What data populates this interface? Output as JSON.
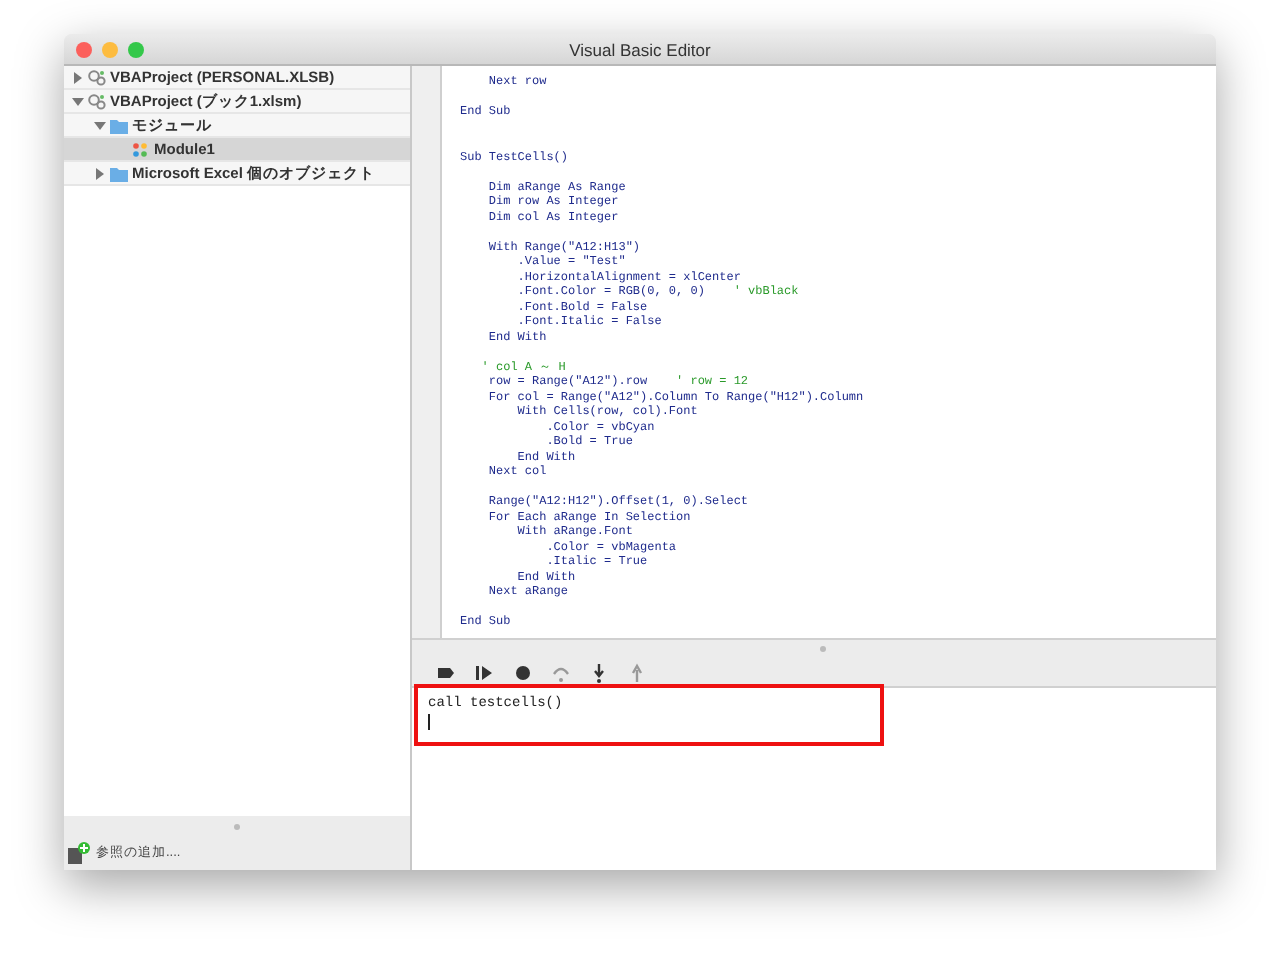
{
  "window": {
    "title": "Visual Basic Editor"
  },
  "project_tree": [
    {
      "label": "VBAProject (PERSONAL.XLSB)",
      "kind": "project",
      "expanded": false,
      "selected": false
    },
    {
      "label": "VBAProject (ブック1.xlsm)",
      "kind": "project",
      "expanded": true,
      "selected": false,
      "children": [
        {
          "label": "モジュール",
          "kind": "folder",
          "expanded": true,
          "selected": false,
          "children": [
            {
              "label": "Module1",
              "kind": "module",
              "selected": true
            }
          ]
        },
        {
          "label": "Microsoft Excel 個のオブジェクト",
          "kind": "folder",
          "expanded": false,
          "selected": false
        }
      ]
    }
  ],
  "footer": {
    "label": "参照の追加...."
  },
  "code_lines": [
    {
      "kind": "code",
      "code": "    Next row"
    },
    {
      "kind": "blank"
    },
    {
      "kind": "code",
      "code": "End Sub"
    },
    {
      "kind": "blank"
    },
    {
      "kind": "blank"
    },
    {
      "kind": "code",
      "code": "Sub TestCells()"
    },
    {
      "kind": "blank"
    },
    {
      "kind": "code",
      "code": "    Dim aRange As Range"
    },
    {
      "kind": "code",
      "code": "    Dim row As Integer"
    },
    {
      "kind": "code",
      "code": "    Dim col As Integer"
    },
    {
      "kind": "blank"
    },
    {
      "kind": "code",
      "code": "    With Range(\"A12:H13\")"
    },
    {
      "kind": "code",
      "code": "        .Value = \"Test\""
    },
    {
      "kind": "code",
      "code": "        .HorizontalAlignment = xlCenter"
    },
    {
      "kind": "code",
      "code": "        .Font.Color = RGB(0, 0, 0)    ",
      "comment": "' vbBlack"
    },
    {
      "kind": "code",
      "code": "        .Font.Bold = False"
    },
    {
      "kind": "code",
      "code": "        .Font.Italic = False"
    },
    {
      "kind": "code",
      "code": "    End With"
    },
    {
      "kind": "blank"
    },
    {
      "kind": "comment",
      "comment": "' col A ～ H"
    },
    {
      "kind": "code",
      "code": "    row = Range(\"A12\").row    ",
      "comment": "' row = 12"
    },
    {
      "kind": "code",
      "code": "    For col = Range(\"A12\").Column To Range(\"H12\").Column"
    },
    {
      "kind": "code",
      "code": "        With Cells(row, col).Font"
    },
    {
      "kind": "code",
      "code": "            .Color = vbCyan"
    },
    {
      "kind": "code",
      "code": "            .Bold = True"
    },
    {
      "kind": "code",
      "code": "        End With"
    },
    {
      "kind": "code",
      "code": "    Next col"
    },
    {
      "kind": "blank"
    },
    {
      "kind": "code",
      "code": "    Range(\"A12:H12\").Offset(1, 0).Select"
    },
    {
      "kind": "code",
      "code": "    For Each aRange In Selection"
    },
    {
      "kind": "code",
      "code": "        With aRange.Font"
    },
    {
      "kind": "code",
      "code": "            .Color = vbMagenta"
    },
    {
      "kind": "code",
      "code": "            .Italic = True"
    },
    {
      "kind": "code",
      "code": "        End With"
    },
    {
      "kind": "code",
      "code": "    Next aRange"
    },
    {
      "kind": "blank"
    },
    {
      "kind": "code",
      "code": "End Sub"
    }
  ],
  "immediate": {
    "text": "call testcells()"
  }
}
